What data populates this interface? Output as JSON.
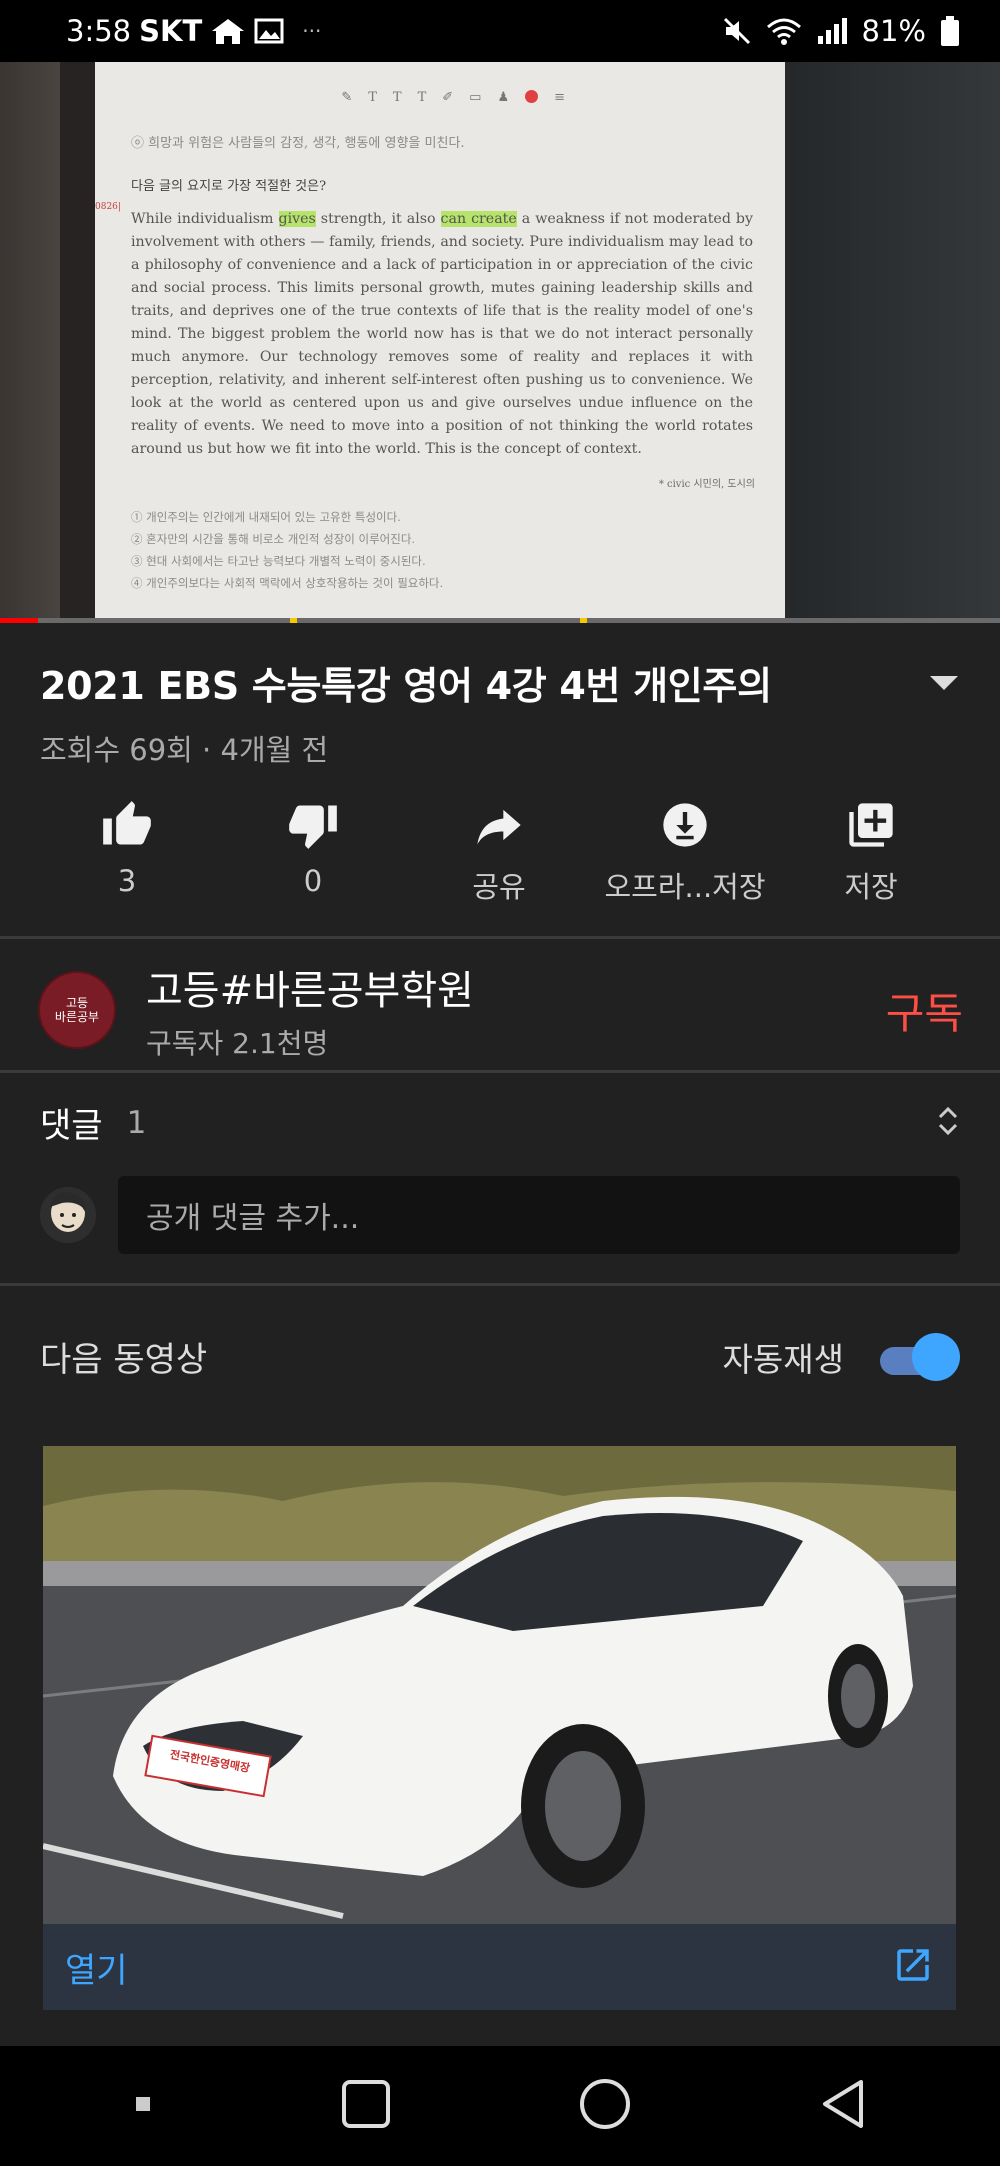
{
  "status_bar": {
    "time": "3:58",
    "carrier": "SKT",
    "dots": "···",
    "battery": "81%"
  },
  "video": {
    "doc_top_line": "ⓞ 희망과 위험은 사람들의 감정, 생각, 행동에 영향을 미친다.",
    "question": "다음 글의 요지로 가장 적절한 것은?",
    "item_number": "0826|",
    "para_start": "While individualism ",
    "hl1": "gives",
    "para_mid": " strength, it also ",
    "hl2": "can create",
    "para_rest": " a weakness if not moderated by involvement with others — family, friends, and society. Pure individualism may lead to a philosophy of convenience and a lack of participation in or appreciation of the civic and social process. This limits personal growth, mutes gaining leadership skills and traits, and deprives one of the true contexts of life that is the reality model of one's mind. The biggest problem the world now has is that we do not interact personally much anymore. Our technology removes some of reality and replaces it with perception, relativity, and inherent self-interest often pushing us to convenience. We look at the world as centered upon us and give ourselves undue influence on the reality of events. We need to move into a position of not thinking the world rotates around us but how we fit into the world. This is the concept of context.",
    "source": "* civic 시민의, 도시의",
    "options": [
      "① 개인주의는 인간에게 내재되어 있는 고유한 특성이다.",
      "② 혼자만의 시간을 통해 비로소 개인적 성장이 이루어진다.",
      "③ 현대 사회에서는 타고난 능력보다 개별적 노력이 중시된다.",
      "④ 개인주의보다는 사회적 맥락에서 상호작용하는 것이 필요하다."
    ]
  },
  "title": "2021 EBS 수능특강 영어 4강 4번 개인주의",
  "meta": "조회수 69회 · 4개월 전",
  "actions": [
    {
      "icon": "thumbs-up-icon",
      "label": "3"
    },
    {
      "icon": "thumbs-down-icon",
      "label": "0"
    },
    {
      "icon": "share-icon",
      "label": "공유"
    },
    {
      "icon": "download-icon",
      "label": "오프라...저장"
    },
    {
      "icon": "add-to-playlist-icon",
      "label": "저장"
    }
  ],
  "channel": {
    "avatar_text_1": "고등",
    "avatar_text_2": "바른공부",
    "name": "고등#바른공부학원",
    "subscribers": "구독자 2.1천명",
    "subscribe_label": "구독"
  },
  "comments": {
    "title": "댓글",
    "count": "1",
    "placeholder": "공개 댓글 추가..."
  },
  "up_next": {
    "title": "다음 동영상",
    "autoplay_label": "자동재생",
    "autoplay_on": true
  },
  "ad": {
    "plate_text": "전국한인증영매장",
    "open_label": "열기"
  },
  "colors": {
    "background": "#212121",
    "accent_blue": "#3ea6ff",
    "subscribe_red": "#ff4e45",
    "progress_red": "#ff0000"
  }
}
